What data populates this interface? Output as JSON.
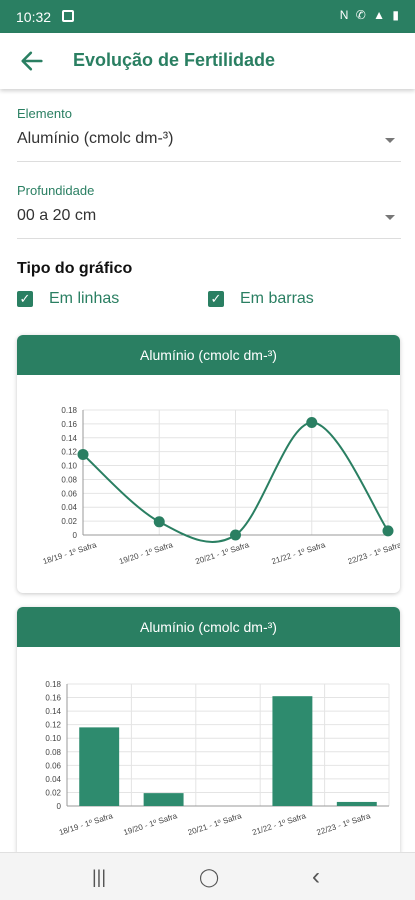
{
  "status": {
    "time": "10:32",
    "icons": "N ✆ ▲ ▮"
  },
  "appbar": {
    "title": "Evolução de Fertilidade"
  },
  "elemento": {
    "label": "Elemento",
    "value": "Alumínio (cmolc dm-³)"
  },
  "profundidade": {
    "label": "Profundidade",
    "value": "00 a 20 cm"
  },
  "tipo": {
    "title": "Tipo do gráfico",
    "linhas": "Em linhas",
    "barras": "Em barras"
  },
  "cards": {
    "line_title": "Alumínio (cmolc dm-³)",
    "bar_title": "Alumínio (cmolc dm-³)"
  },
  "nav": {
    "recents": "|||",
    "home": "◯",
    "back": "‹"
  },
  "colors": {
    "accent": "#2a7f62",
    "bar": "#2e8b6e"
  },
  "chart_data": [
    {
      "type": "line",
      "categories": [
        "18/19 - 1º Safra",
        "19/20 - 1º Safra",
        "20/21 - 1º Safra",
        "21/22 - 1º Safra",
        "22/23 - 1º Safra"
      ],
      "values": [
        0.116,
        0.019,
        0.0,
        0.162,
        0.006
      ],
      "ylim": [
        0,
        0.18
      ],
      "yticks": [
        "0",
        "0.02",
        "0.04",
        "0.06",
        "0.08",
        "0.10",
        "0.12",
        "0.14",
        "0.16",
        "0.18"
      ]
    },
    {
      "type": "bar",
      "categories": [
        "18/19 - 1º Safra",
        "19/20 - 1º Safra",
        "20/21 - 1º Safra",
        "21/22 - 1º Safra",
        "22/23 - 1º Safra"
      ],
      "values": [
        0.116,
        0.019,
        0.0,
        0.162,
        0.006
      ],
      "ylim": [
        0,
        0.18
      ],
      "yticks": [
        "0",
        "0.02",
        "0.04",
        "0.06",
        "0.08",
        "0.10",
        "0.12",
        "0.14",
        "0.16",
        "0.18"
      ]
    }
  ]
}
